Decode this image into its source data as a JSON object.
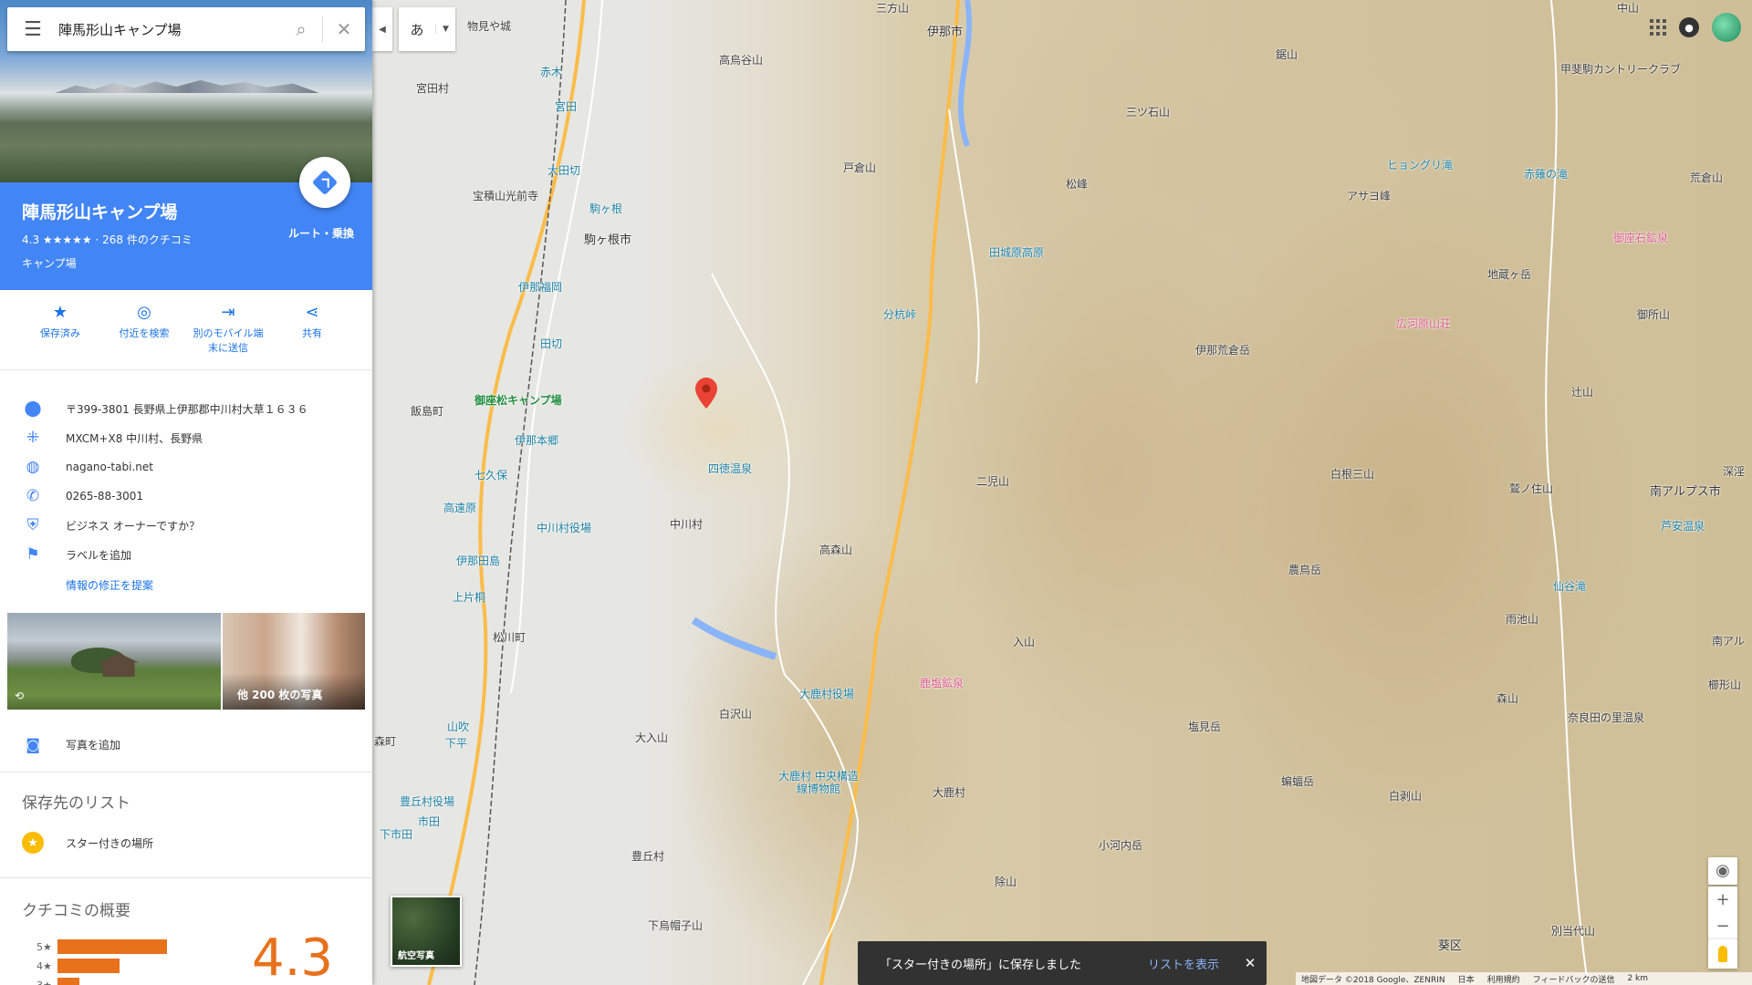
{
  "search": {
    "query": "陣馬形山キャンプ場"
  },
  "ime": {
    "mode": "あ"
  },
  "place": {
    "title": "陣馬形山キャンプ場",
    "rating_line": "4.3 ★★★★★ · 268 件のクチコミ",
    "category": "キャンプ場",
    "route_label": "ルート・乗換"
  },
  "actions": [
    {
      "label": "保存済み",
      "icon": "bookmark-star-icon"
    },
    {
      "label": "付近を検索",
      "icon": "nearby-icon"
    },
    {
      "label": "別のモバイル端末に送信",
      "label_line1": "別のモバイル端",
      "label_line2": "末に送信",
      "icon": "send-to-phone-icon"
    },
    {
      "label": "共有",
      "icon": "share-icon"
    }
  ],
  "info": {
    "address": "〒399-3801 長野県上伊那郡中川村大草１６３６",
    "plus_code": "MXCM+X8 中川村、長野県",
    "website": "nagano-tabi.net",
    "phone": "0265-88-3001",
    "owner": "ビジネス オーナーですか？",
    "label": "ラベルを追加",
    "suggest_edit": "情報の修正を提案"
  },
  "photos": {
    "more_label": "他 200 枚の写真",
    "add_label": "写真を追加"
  },
  "lists": {
    "title": "保存先のリスト",
    "starred": "スター付きの場所"
  },
  "reviews": {
    "title": "クチコミの概要",
    "score": "4.3",
    "bars": [
      {
        "stars": "5",
        "fraction": 0.78
      },
      {
        "stars": "4",
        "fraction": 0.42
      },
      {
        "stars": "3",
        "fraction": 0.1
      }
    ]
  },
  "map": {
    "satellite_label": "航空写真",
    "toast": {
      "message": "「スター付きの場所」に保存しました",
      "link": "リストを表示"
    },
    "footer": {
      "data": "地図データ ©2018 Google、ZENRIN",
      "region": "日本",
      "terms": "利用規約",
      "feedback": "フィードバックの送信",
      "scale": "2 km"
    },
    "labels": [
      {
        "text": "伊那市",
        "type": "city"
      },
      {
        "text": "駒ヶ根市",
        "type": "city"
      },
      {
        "text": "中川村",
        "type": "city"
      },
      {
        "text": "宮田村",
        "type": "city"
      },
      {
        "text": "飯島町",
        "type": "city"
      },
      {
        "text": "松川町",
        "type": "city"
      },
      {
        "text": "豊丘村",
        "type": "city"
      },
      {
        "text": "大鹿村",
        "type": "city"
      },
      {
        "text": "南アルプス市",
        "type": "city"
      },
      {
        "text": "御座松キャンプ場",
        "type": "green"
      },
      {
        "text": "高烏谷山",
        "type": "peak"
      },
      {
        "text": "戸倉山",
        "type": "peak"
      },
      {
        "text": "松峰",
        "type": "peak"
      },
      {
        "text": "三ツ石山",
        "type": "peak"
      },
      {
        "text": "鋸山",
        "type": "peak"
      },
      {
        "text": "甲斐駒カントリークラブ",
        "type": "peak"
      },
      {
        "text": "アサヨ峰",
        "type": "peak"
      },
      {
        "text": "地蔵ヶ岳",
        "type": "peak"
      },
      {
        "text": "伊那荒倉岳",
        "type": "peak"
      },
      {
        "text": "御所山",
        "type": "peak"
      },
      {
        "text": "辻山",
        "type": "peak"
      },
      {
        "text": "二児山",
        "type": "peak"
      },
      {
        "text": "白根三山",
        "type": "peak"
      },
      {
        "text": "鷲ノ住山",
        "type": "peak"
      },
      {
        "text": "高森山",
        "type": "peak"
      },
      {
        "text": "農鳥岳",
        "type": "peak"
      },
      {
        "text": "入山",
        "type": "peak"
      },
      {
        "text": "雨池山",
        "type": "peak"
      },
      {
        "text": "白沢山",
        "type": "peak"
      },
      {
        "text": "大入山",
        "type": "peak"
      },
      {
        "text": "塩見岳",
        "type": "peak"
      },
      {
        "text": "森山",
        "type": "peak"
      },
      {
        "text": "櫛形山",
        "type": "peak"
      },
      {
        "text": "蝙蝠岳",
        "type": "peak"
      },
      {
        "text": "白剥山",
        "type": "peak"
      },
      {
        "text": "小河内岳",
        "type": "peak"
      },
      {
        "text": "除山",
        "type": "peak"
      },
      {
        "text": "下烏帽子山",
        "type": "peak"
      },
      {
        "text": "別当代山",
        "type": "peak"
      },
      {
        "text": "荒倉山",
        "type": "peak"
      },
      {
        "text": "分杭峠",
        "type": "teal"
      },
      {
        "text": "四徳温泉",
        "type": "teal"
      },
      {
        "text": "田城原高原",
        "type": "teal"
      },
      {
        "text": "ヒョングリ滝",
        "type": "teal"
      },
      {
        "text": "赤薙の滝",
        "type": "teal"
      },
      {
        "text": "仙谷滝",
        "type": "teal"
      },
      {
        "text": "芦安温泉",
        "type": "teal"
      },
      {
        "text": "御座石鉱泉",
        "type": "pink"
      },
      {
        "text": "広河原山荘",
        "type": "pink"
      },
      {
        "text": "鹿塩鉱泉",
        "type": "pink"
      },
      {
        "text": "奈良田の里温泉",
        "type": "city"
      },
      {
        "text": "大鹿村役場",
        "type": "teal"
      },
      {
        "text": "大鹿村 中央構造線博物館",
        "type": "teal"
      },
      {
        "text": "中川村役場",
        "type": "teal"
      },
      {
        "text": "豊丘村役場",
        "type": "teal"
      },
      {
        "text": "宝積山光前寺",
        "type": "city"
      },
      {
        "text": "赤木",
        "type": "teal"
      },
      {
        "text": "宮田",
        "type": "teal"
      },
      {
        "text": "大田切",
        "type": "teal"
      },
      {
        "text": "駒ヶ根",
        "type": "teal"
      },
      {
        "text": "伊那福岡",
        "type": "teal"
      },
      {
        "text": "田切",
        "type": "teal"
      },
      {
        "text": "伊那本郷",
        "type": "teal"
      },
      {
        "text": "七久保",
        "type": "teal"
      },
      {
        "text": "高遠原",
        "type": "teal"
      },
      {
        "text": "伊那田島",
        "type": "teal"
      },
      {
        "text": "上片桐",
        "type": "teal"
      },
      {
        "text": "山吹",
        "type": "teal"
      },
      {
        "text": "下平",
        "type": "teal"
      },
      {
        "text": "市田",
        "type": "teal"
      },
      {
        "text": "下市田",
        "type": "teal"
      },
      {
        "text": "物見や城",
        "type": "city"
      },
      {
        "text": "葵区",
        "type": "city"
      },
      {
        "text": "深淫",
        "type": "city"
      },
      {
        "text": "南アル",
        "type": "city"
      },
      {
        "text": "中山",
        "type": "peak"
      },
      {
        "text": "三方山",
        "type": "peak"
      },
      {
        "text": "森町",
        "type": "city"
      }
    ]
  }
}
